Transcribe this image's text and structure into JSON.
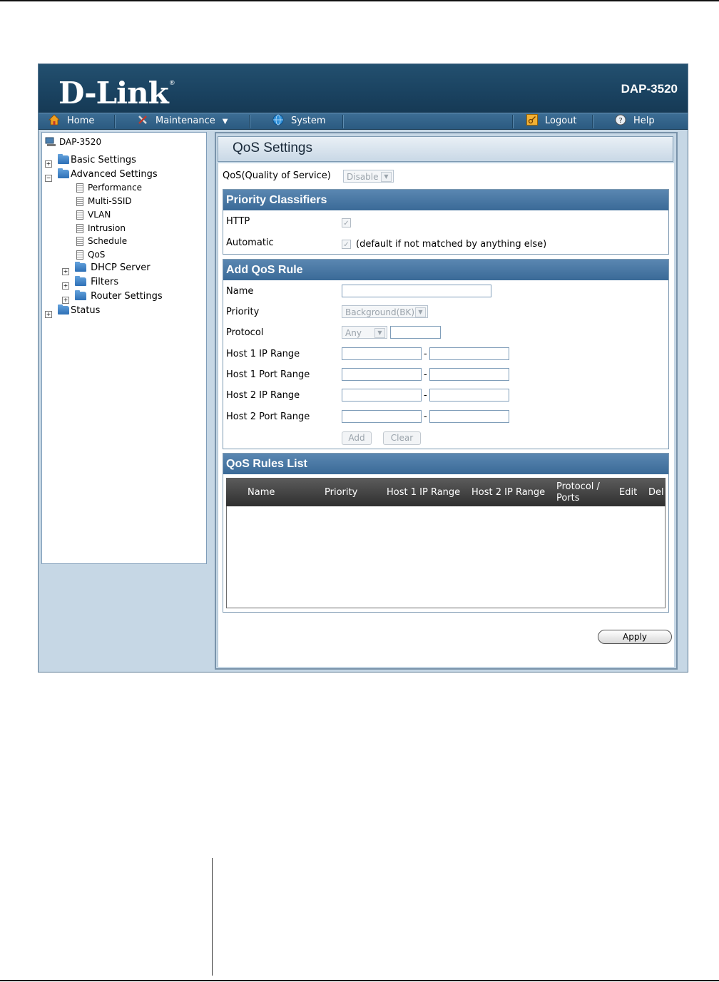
{
  "brand": {
    "logo": "D-Link",
    "model": "DAP-3520"
  },
  "nav": {
    "home": "Home",
    "maintenance": "Maintenance",
    "system": "System",
    "logout": "Logout",
    "help": "Help"
  },
  "tree": {
    "root": "DAP-3520",
    "basic": "Basic Settings",
    "advanced": "Advanced Settings",
    "performance": "Performance",
    "multi_ssid": "Multi-SSID",
    "vlan": "VLAN",
    "intrusion": "Intrusion",
    "schedule": "Schedule",
    "qos": "QoS",
    "dhcp": "DHCP Server",
    "filters": "Filters",
    "router": "Router Settings",
    "status": "Status"
  },
  "page": {
    "title": "QoS Settings",
    "qos_label": "QoS(Quality of Service)",
    "qos_value": "Disable"
  },
  "classifiers": {
    "heading": "Priority Classifiers",
    "http": "HTTP",
    "automatic": "Automatic",
    "automatic_note": "(default if not matched by anything else)"
  },
  "rule": {
    "heading": "Add QoS Rule",
    "name": "Name",
    "priority": "Priority",
    "priority_value": "Background(BK)",
    "protocol": "Protocol",
    "protocol_value": "Any",
    "host1_ip": "Host 1 IP Range",
    "host1_port": "Host 1 Port Range",
    "host2_ip": "Host 2 IP Range",
    "host2_port": "Host 2 Port Range",
    "dash": "-",
    "add": "Add",
    "clear": "Clear"
  },
  "rules_list": {
    "heading": "QoS Rules List",
    "columns": [
      "Name",
      "Priority",
      "Host 1 IP Range",
      "Host 2 IP Range",
      "Protocol /",
      "Ports",
      "Edit",
      "Del"
    ]
  },
  "apply": "Apply"
}
